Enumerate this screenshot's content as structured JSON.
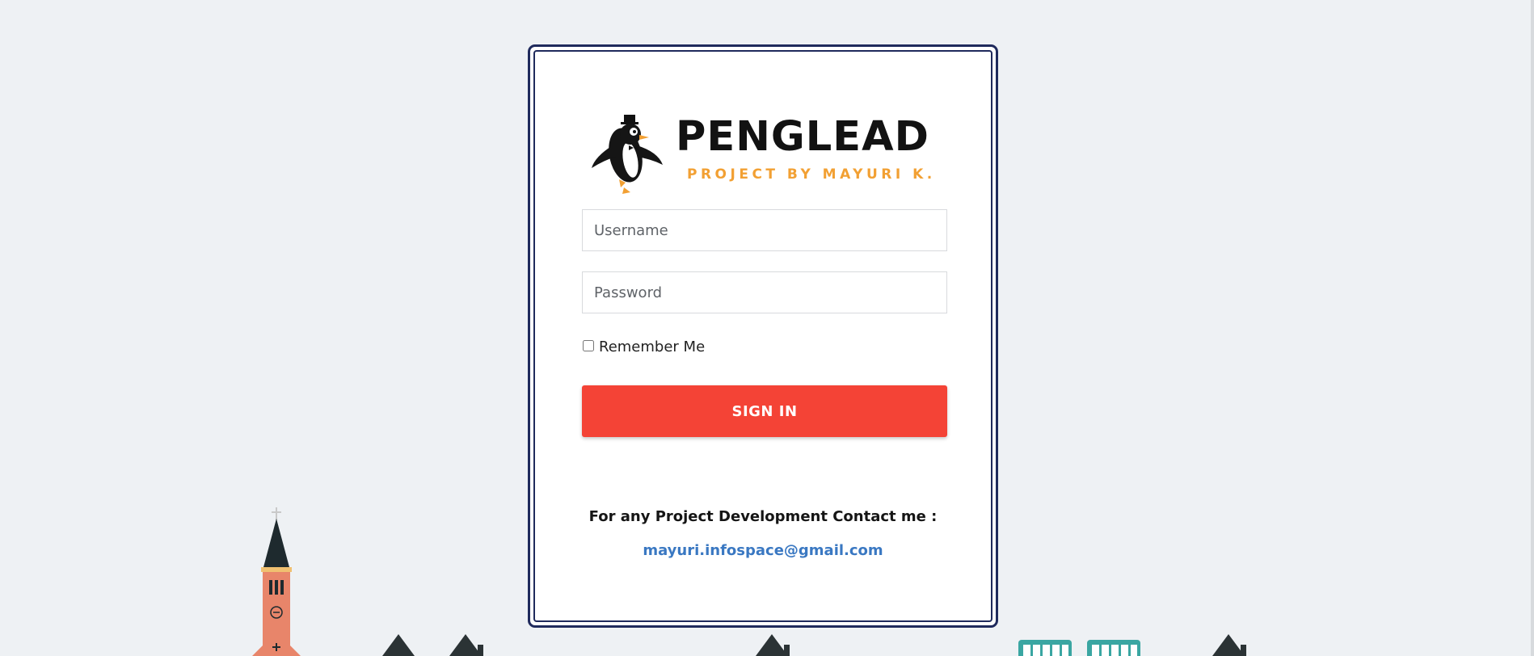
{
  "brand": {
    "name": "PENGLEAD",
    "tagline": "PROJECT BY MAYURI K."
  },
  "form": {
    "username_placeholder": "Username",
    "password_placeholder": "Password",
    "remember_label": "Remember Me",
    "signin_label": "SIGN IN"
  },
  "contact": {
    "text": "For any Project Development Contact me :",
    "email": "mayuri.infospace@gmail.com"
  },
  "colors": {
    "background": "#eef1f4",
    "card_border": "#1f2a5c",
    "signin_button": "#f44336",
    "tagline": "#f2a033",
    "email_link": "#3a78c2"
  },
  "icons": {
    "logo": "penguin-icon",
    "skyline": "city-skyline-illustration"
  }
}
